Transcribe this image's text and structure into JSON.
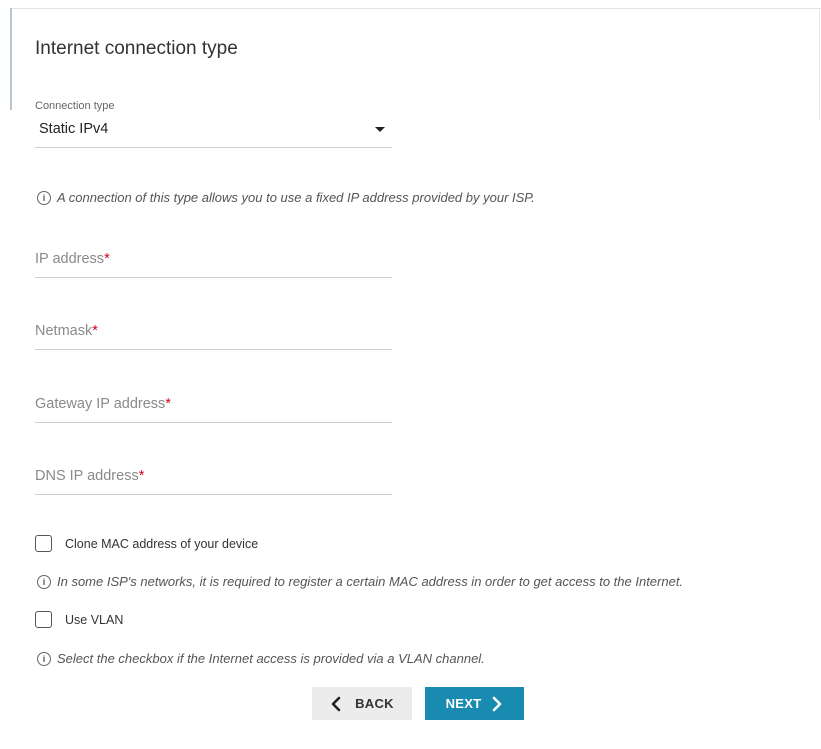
{
  "page": {
    "title": "Internet connection type"
  },
  "connection_type": {
    "label": "Connection type",
    "value": "Static IPv4",
    "hint": "A connection of this type allows you to use a fixed IP address provided by your ISP."
  },
  "fields": {
    "ip_address": {
      "label": "IP address",
      "required_mark": "*",
      "value": ""
    },
    "netmask": {
      "label": "Netmask",
      "required_mark": "*",
      "value": ""
    },
    "gateway": {
      "label": "Gateway IP address",
      "required_mark": "*",
      "value": ""
    },
    "dns": {
      "label": "DNS IP address",
      "required_mark": "*",
      "value": ""
    }
  },
  "clone_mac": {
    "label": "Clone MAC address of your device",
    "checked": false,
    "hint": "In some ISP's networks, it is required to register a certain MAC address in order to get access to the Internet."
  },
  "vlan": {
    "label": "Use VLAN",
    "checked": false,
    "hint": "Select the checkbox if the Internet access is provided via a VLAN channel."
  },
  "buttons": {
    "back_label": "BACK",
    "next_label": "NEXT"
  },
  "icons": {
    "info": "info-icon",
    "dropdown": "chevron-down-icon",
    "back": "chevron-left-icon",
    "next": "chevron-right-icon"
  },
  "colors": {
    "accent": "#1a8bb0",
    "required": "#d0021b"
  }
}
